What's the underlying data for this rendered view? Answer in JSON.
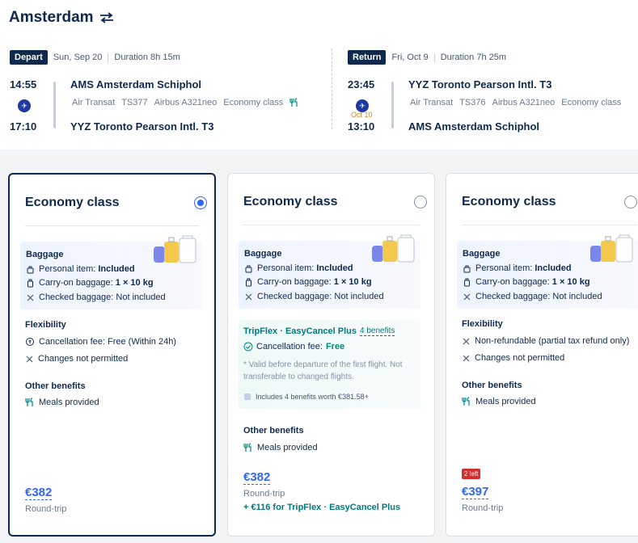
{
  "header": {
    "city": "Amsterdam",
    "swap_icon": "swap-arrows-icon"
  },
  "depart": {
    "tag": "Depart",
    "date": "Sun, Sep 20",
    "duration": "Duration 8h 15m",
    "dep_time": "14:55",
    "arr_time": "17:10",
    "dep_airport": "AMS Amsterdam Schiphol",
    "arr_airport": "YYZ Toronto Pearson Intl. T3",
    "airline": "Air Transat",
    "flight_no": "TS377",
    "aircraft": "Airbus A321neo",
    "cabin": "Economy class",
    "meal_icon": "meal-icon"
  },
  "return": {
    "tag": "Return",
    "date": "Fri, Oct 9",
    "duration": "Duration 7h 25m",
    "dep_time": "23:45",
    "arr_time": "13:10",
    "next_day": "Oct 10",
    "dep_airport": "YYZ Toronto Pearson Intl. T3",
    "arr_airport": "AMS Amsterdam Schiphol",
    "airline": "Air Transat",
    "flight_no": "TS376",
    "aircraft": "Airbus A321neo",
    "cabin": "Economy class"
  },
  "cards": [
    {
      "title": "Economy class",
      "selected": true,
      "baggage": {
        "title": "Baggage",
        "personal_label": "Personal item: ",
        "personal_value": "Included",
        "carry_label": "Carry-on baggage: ",
        "carry_value": "1 × 10 kg",
        "checked": "Checked baggage: Not included"
      },
      "flex_title": "Flexibility",
      "flex_1": "Cancellation fee: Free (Within 24h)",
      "flex_2": "Changes not permitted",
      "other_title": "Other benefits",
      "other_1": "Meals provided",
      "price": "€382",
      "price_note": "Round-trip"
    },
    {
      "title": "Economy class",
      "selected": false,
      "baggage": {
        "title": "Baggage",
        "personal_label": "Personal item: ",
        "personal_value": "Included",
        "carry_label": "Carry-on baggage: ",
        "carry_value": "1 × 10 kg",
        "checked": "Checked baggage: Not included"
      },
      "tripflex": {
        "title": "TripFlex · EasyCancel Plus",
        "link": "4 benefits",
        "cancel_label": "Cancellation fee: ",
        "cancel_value": "Free",
        "note": "* Valid before departure of the first flight. Not transferable to changed flights.",
        "benefits": "Includes 4 benefits worth €381.58+"
      },
      "other_title": "Other benefits",
      "other_1": "Meals provided",
      "price": "€382",
      "price_note": "Round-trip",
      "extra": "+ €116 for TripFlex · EasyCancel Plus"
    },
    {
      "title": "Economy class",
      "selected": false,
      "baggage": {
        "title": "Baggage",
        "personal_label": "Personal item: ",
        "personal_value": "Included",
        "carry_label": "Carry-on baggage: ",
        "carry_value": "1 × 10 kg",
        "checked": "Checked baggage: Not included"
      },
      "flex_title": "Flexibility",
      "flex_1": "Non-refundable (partial tax refund only)",
      "flex_2": "Changes not permitted",
      "other_title": "Other benefits",
      "other_1": "Meals provided",
      "seats_left": "2 left",
      "price": "€397",
      "price_note": "Round-trip"
    }
  ],
  "colors": {
    "navy": "#0f294d",
    "blue": "#3264ff",
    "teal": "#007a80",
    "red": "#d32f2f"
  }
}
